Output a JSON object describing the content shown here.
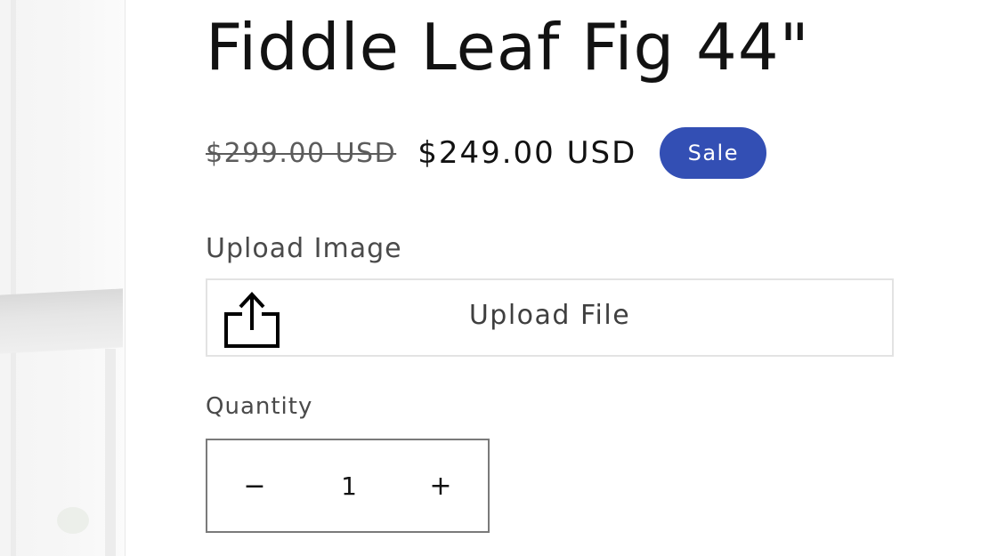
{
  "product": {
    "title": "Fiddle Leaf Fig 44\"",
    "price_compare": "$299.00 USD",
    "price_sale": "$249.00 USD",
    "badge": "Sale"
  },
  "upload": {
    "label": "Upload Image",
    "button_text": "Upload File",
    "icon": "share-upload-icon"
  },
  "quantity": {
    "label": "Quantity",
    "value": "1",
    "decrease_symbol": "−",
    "increase_symbol": "+"
  },
  "colors": {
    "badge_bg": "#334fb4",
    "text": "#121212",
    "muted_text": "#5c5c5c"
  }
}
